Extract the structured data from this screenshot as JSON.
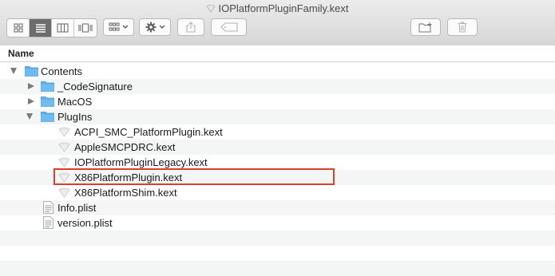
{
  "window": {
    "title": "IOPlatformPluginFamily.kext"
  },
  "toolbar": {
    "view_buttons": [
      "icon-view-icon",
      "list-view-icon",
      "column-view-icon",
      "cover-flow-icon"
    ],
    "active_view": 1,
    "arrange_icon": "arrange-grid-icon",
    "action_icon": "gear-icon",
    "share_icon": "share-icon",
    "tag_icon": "tag-icon",
    "new_folder_icon": "new-folder-icon",
    "trash_icon": "trash-icon"
  },
  "columns": {
    "name": "Name"
  },
  "files": [
    {
      "name": "Contents",
      "type": "folder",
      "expanded": true
    },
    {
      "name": "_CodeSignature",
      "type": "folder",
      "expanded": false
    },
    {
      "name": "MacOS",
      "type": "folder",
      "expanded": false
    },
    {
      "name": "PlugIns",
      "type": "folder",
      "expanded": true
    },
    {
      "name": "ACPI_SMC_PlatformPlugin.kext",
      "type": "kext"
    },
    {
      "name": "AppleSMCPDRC.kext",
      "type": "kext"
    },
    {
      "name": "IOPlatformPluginLegacy.kext",
      "type": "kext"
    },
    {
      "name": "X86PlatformPlugin.kext",
      "type": "kext",
      "highlighted": true
    },
    {
      "name": "X86PlatformShim.kext",
      "type": "kext"
    },
    {
      "name": "Info.plist",
      "type": "plist"
    },
    {
      "name": "version.plist",
      "type": "plist"
    }
  ],
  "colors": {
    "highlight": "#d9402a",
    "folder": "#4aa8e8"
  }
}
